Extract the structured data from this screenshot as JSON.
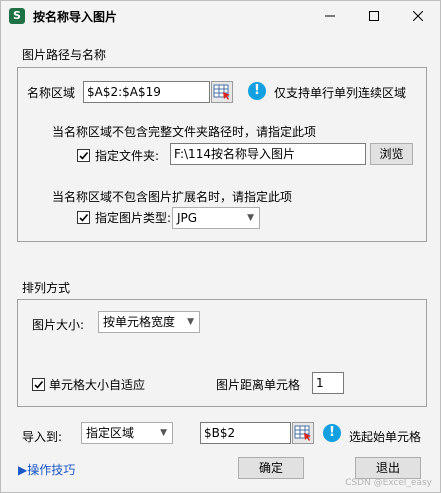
{
  "window": {
    "app_icon": "S",
    "title": "按名称导入图片"
  },
  "path_section": {
    "label": "图片路径与名称",
    "name_range_label": "名称区域",
    "name_range_value": "$A$2:$A$19",
    "name_range_hint": "仅支持单行单列连续区域",
    "folder_note": "当名称区域不包含完整文件夹路径时，请指定此项",
    "folder_checkbox_label": "指定文件夹:",
    "folder_checked": true,
    "folder_value": "F:\\114按名称导入图片",
    "browse_label": "浏览",
    "ext_note": "当名称区域不包含图片扩展名时，请指定此项",
    "ext_checkbox_label": "指定图片类型:",
    "ext_checked": true,
    "ext_value": "JPG"
  },
  "arrange_section": {
    "label": "排列方式",
    "size_label": "图片大小:",
    "size_value": "按单元格宽度",
    "autofit_label": "单元格大小自适应",
    "autofit_checked": true,
    "distance_label": "图片距离单元格",
    "distance_value": "1"
  },
  "import": {
    "label": "导入到:",
    "target_value": "指定区域",
    "cell_value": "$B$2",
    "cell_hint": "选起始单元格"
  },
  "footer": {
    "tips_link": "▶操作技巧",
    "ok_label": "确定",
    "exit_label": "退出",
    "watermark": "CSDN @Excel_easy"
  },
  "colors": {
    "accent_info": "#12a0e0",
    "link": "#1b56c9",
    "app_icon_bg": "#1e7145"
  }
}
